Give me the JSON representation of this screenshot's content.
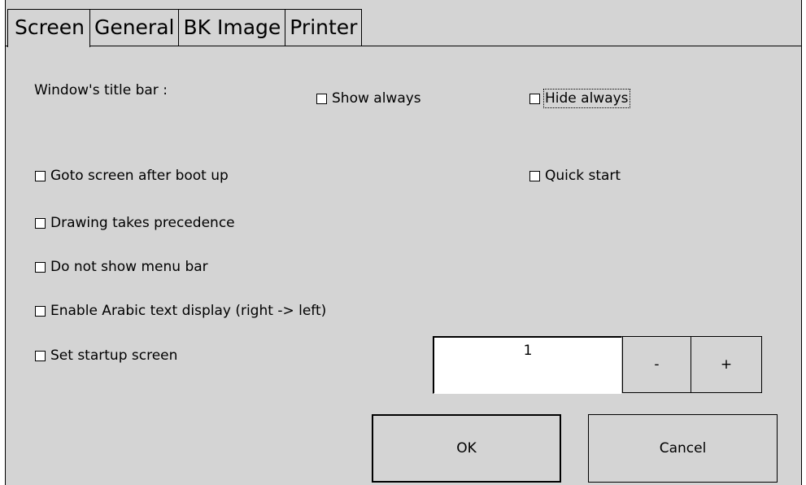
{
  "tabs": [
    {
      "label": "Screen"
    },
    {
      "label": "General"
    },
    {
      "label": "BK Image"
    },
    {
      "label": "Printer"
    }
  ],
  "title_bar": {
    "label": "Window's title bar :",
    "show_always": "Show always",
    "hide_always": "Hide always"
  },
  "options": {
    "goto_screen": "Goto screen after boot up",
    "quick_start": "Quick start",
    "drawing_precedence": "Drawing takes precedence",
    "no_menu_bar": "Do not show menu bar",
    "arabic": "Enable Arabic text display (right -> left)",
    "startup_screen": "Set startup screen"
  },
  "startup": {
    "value": "1",
    "minus": "-",
    "plus": "+"
  },
  "buttons": {
    "ok": "OK",
    "cancel": "Cancel"
  }
}
